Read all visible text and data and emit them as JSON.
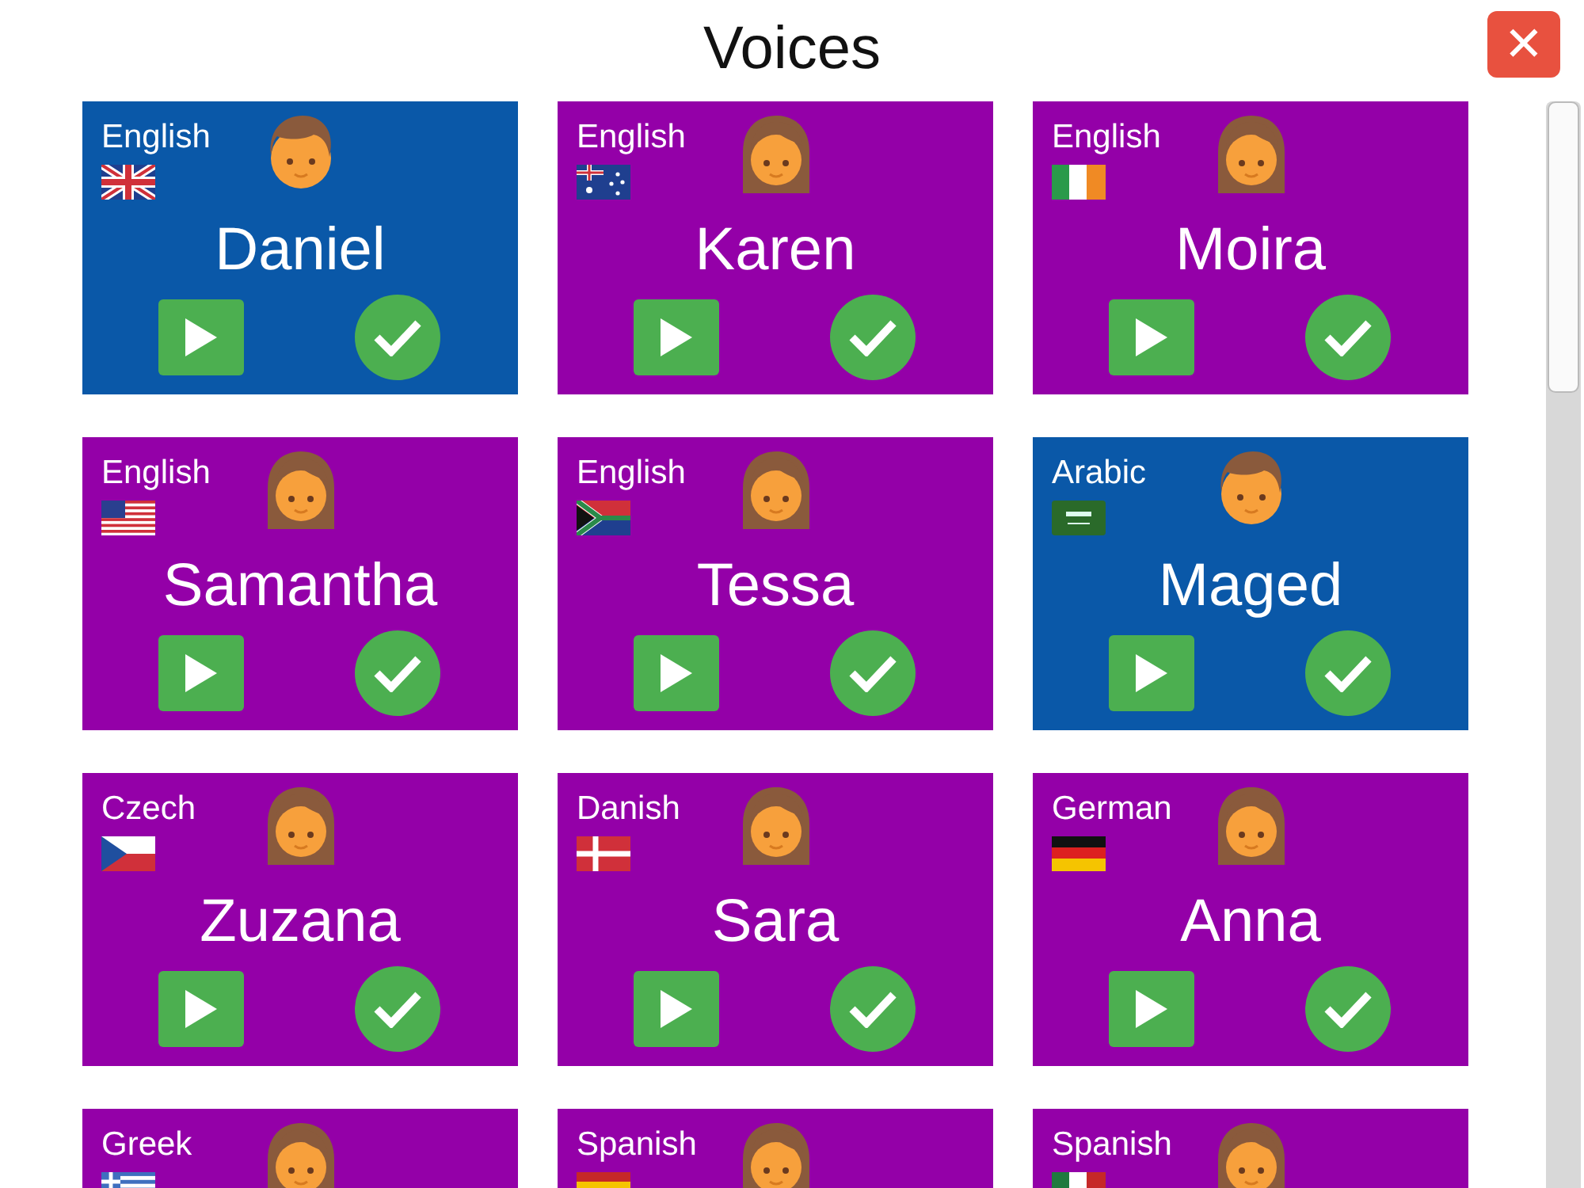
{
  "title": "Voices",
  "close_button": {
    "label": "✕"
  },
  "voices": [
    {
      "language": "English",
      "name": "Daniel",
      "avatar": {
        "kind": "male"
      },
      "flag": {
        "kind": "gb"
      }
    },
    {
      "language": "English",
      "name": "Karen",
      "avatar": {
        "kind": "female"
      },
      "flag": {
        "kind": "au"
      }
    },
    {
      "language": "English",
      "name": "Moira",
      "avatar": {
        "kind": "female"
      },
      "flag": {
        "kind": "ie"
      }
    },
    {
      "language": "English",
      "name": "Samantha",
      "avatar": {
        "kind": "female"
      },
      "flag": {
        "kind": "us"
      }
    },
    {
      "language": "English",
      "name": "Tessa",
      "avatar": {
        "kind": "female"
      },
      "flag": {
        "kind": "za"
      }
    },
    {
      "language": "Arabic",
      "name": "Maged",
      "avatar": {
        "kind": "male"
      },
      "flag": {
        "kind": "sa"
      }
    },
    {
      "language": "Czech",
      "name": "Zuzana",
      "avatar": {
        "kind": "female"
      },
      "flag": {
        "kind": "cz"
      }
    },
    {
      "language": "Danish",
      "name": "Sara",
      "avatar": {
        "kind": "female"
      },
      "flag": {
        "kind": "dk"
      }
    },
    {
      "language": "German",
      "name": "Anna",
      "avatar": {
        "kind": "female"
      },
      "flag": {
        "kind": "de"
      }
    },
    {
      "language": "Greek",
      "avatar": {
        "kind": "female"
      },
      "flag": {
        "kind": "gr"
      }
    },
    {
      "language": "Spanish",
      "avatar": {
        "kind": "female"
      },
      "flag": {
        "kind": "es"
      }
    },
    {
      "language": "Spanish",
      "avatar": {
        "kind": "female"
      },
      "flag": {
        "kind": "mx"
      }
    }
  ]
}
